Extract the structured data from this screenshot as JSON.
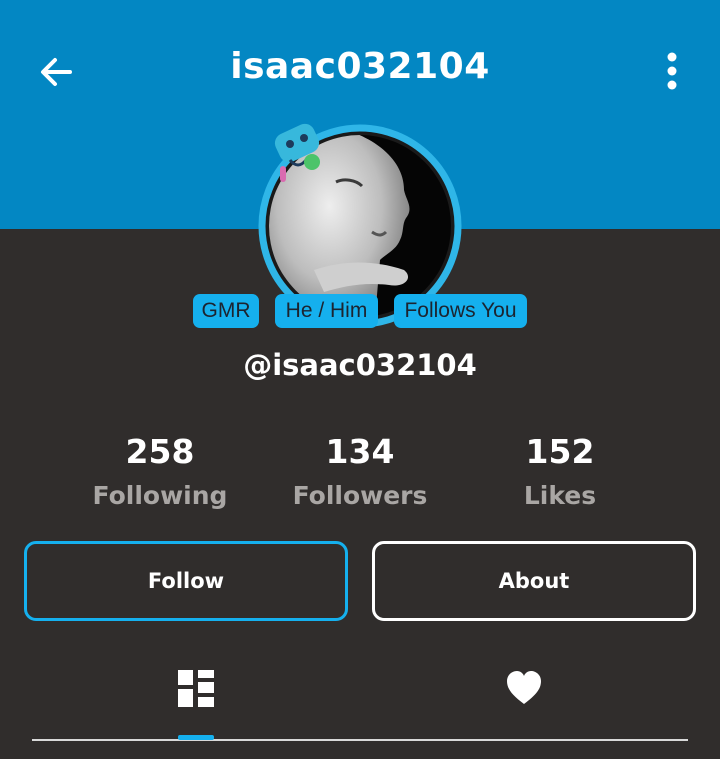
{
  "header": {
    "title": "isaac032104",
    "back_icon": "arrow-left-icon",
    "more_icon": "more-vertical-icon",
    "background_color": "#0387c3"
  },
  "profile": {
    "handle": "@isaac032104",
    "badges": [
      "GMR",
      "He / Him",
      "Follows You"
    ],
    "badge_color": "#15b0ee"
  },
  "stats": [
    {
      "value": "258",
      "label": "Following"
    },
    {
      "value": "134",
      "label": "Followers"
    },
    {
      "value": "152",
      "label": "Likes"
    }
  ],
  "actions": {
    "follow_label": "Follow",
    "about_label": "About"
  },
  "tabs": [
    {
      "icon": "grid-icon",
      "active": true
    },
    {
      "icon": "heart-icon",
      "active": false
    }
  ],
  "colors": {
    "background": "#302d2c",
    "accent": "#15b0ee"
  }
}
